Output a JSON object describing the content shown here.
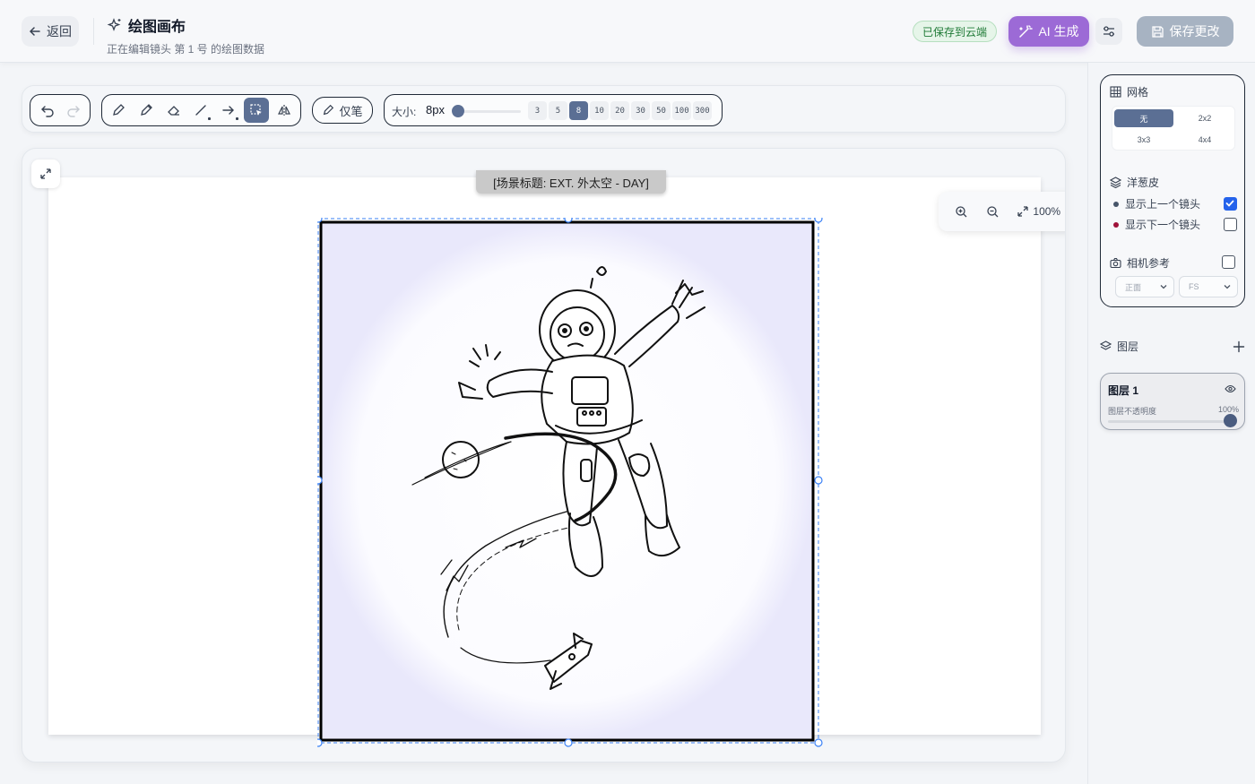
{
  "header": {
    "back_label": "返回",
    "title": "绘图画布",
    "subtitle": "正在编辑镜头 第 1 号 的绘图数据",
    "saved_badge": "已保存到云端",
    "ai_label": "AI 生成",
    "save_label": "保存更改"
  },
  "toolbar": {
    "pen_only_label": "仅笔",
    "size_label": "大小:",
    "size_value": "8px",
    "size_presets": [
      "3",
      "5",
      "8",
      "10",
      "20",
      "30",
      "50",
      "100",
      "300"
    ],
    "active_preset": "8",
    "active_tool": "select-icon"
  },
  "canvas": {
    "scene_heading": "[场景标题: EXT. 外太空 - DAY]",
    "zoom_level": "100%"
  },
  "right_panel": {
    "grid": {
      "title": "网格",
      "options": [
        "无",
        "2x2",
        "3x3",
        "4x4"
      ],
      "selected": "无"
    },
    "onion": {
      "title": "洋葱皮",
      "show_prev": "显示上一个镜头",
      "show_next": "显示下一个镜头",
      "prev_checked": true,
      "next_checked": false,
      "prev_color": "#475569",
      "next_color": "#9f1239"
    },
    "camera": {
      "title": "相机参考",
      "checked": false,
      "angle": "正面",
      "shot": "FS"
    },
    "layers": {
      "title": "图层",
      "items": [
        {
          "name": "图层 1",
          "opacity_label": "图层不透明度",
          "opacity_value": "100%"
        }
      ]
    }
  },
  "colors": {
    "accent": "#5b6f94",
    "ai": "#9c6ad6",
    "save_disabled": "#a7b3c2",
    "selection": "#3b82f6"
  }
}
